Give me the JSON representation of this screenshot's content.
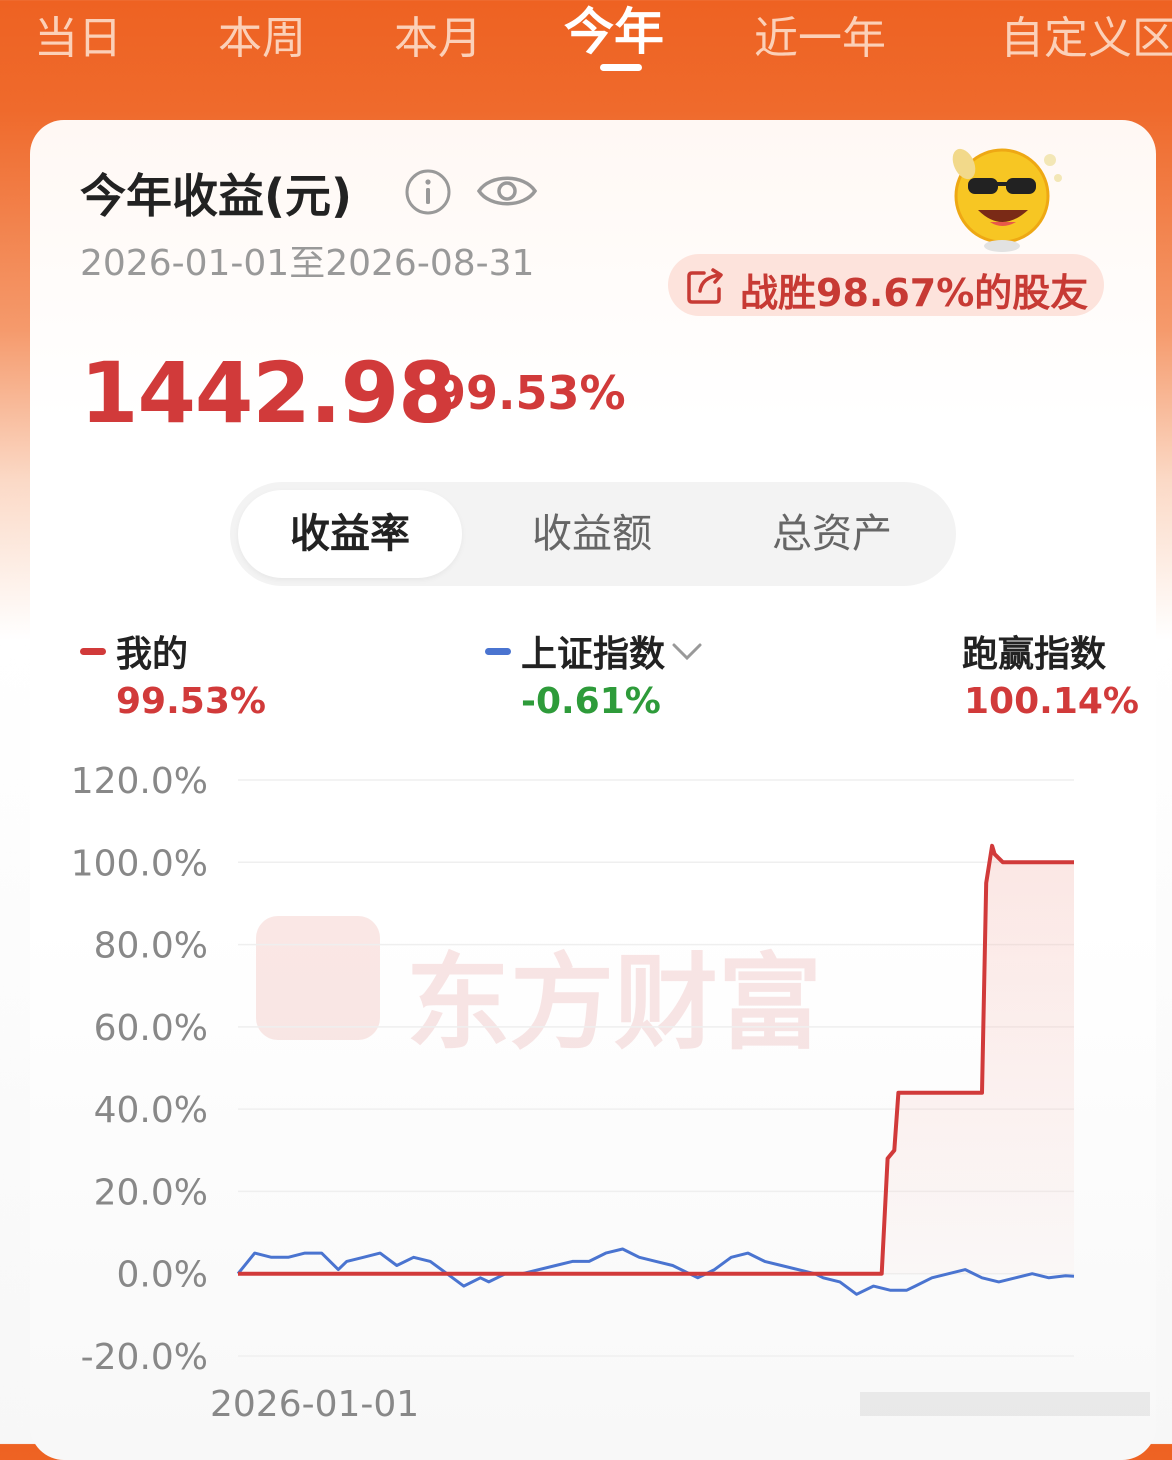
{
  "period_tabs": [
    {
      "label": "当日",
      "active": false
    },
    {
      "label": "本周",
      "active": false
    },
    {
      "label": "本月",
      "active": false
    },
    {
      "label": "今年",
      "active": true
    },
    {
      "label": "近一年",
      "active": false
    },
    {
      "label": "自定义区",
      "active": false
    }
  ],
  "card": {
    "title": "今年收益(元)",
    "date_range": "2026-01-01至2026-08-31",
    "beat_text": "战胜98.67%的股友",
    "amount": "1442.98",
    "amount_rate": "99.53%"
  },
  "segments": [
    {
      "label": "收益率",
      "active": true
    },
    {
      "label": "收益额",
      "active": false
    },
    {
      "label": "总资产",
      "active": false
    }
  ],
  "legend": {
    "mine": {
      "name": "我的",
      "value": "99.53%"
    },
    "index": {
      "name": "上证指数",
      "value": "-0.61%"
    },
    "outperform": {
      "name": "跑赢指数",
      "value": "100.14%"
    }
  },
  "colors": {
    "brand_orange": "#ee6222",
    "up_red": "#d13a3a",
    "down_green": "#2e9b3a",
    "index_blue": "#4a74d0"
  },
  "watermark": {
    "text": "东方财富"
  },
  "chart_data": {
    "type": "line",
    "ylim": [
      -20,
      120
    ],
    "yticks": [
      "120.0%",
      "100.0%",
      "80.0%",
      "60.0%",
      "40.0%",
      "20.0%",
      "0.0%",
      "-20.0%"
    ],
    "x_start_label": "2026-01-01",
    "series": [
      {
        "name": "我的",
        "x": [
          0,
          0.77,
          0.777,
          0.785,
          0.79,
          0.795,
          0.8,
          0.89,
          0.895,
          0.902,
          0.905,
          0.915,
          0.93,
          1.0
        ],
        "values": [
          0,
          0,
          28,
          30,
          44,
          44,
          44,
          44,
          95,
          104,
          102,
          100,
          100,
          100
        ]
      },
      {
        "name": "上证指数",
        "x": [
          0,
          0.02,
          0.04,
          0.06,
          0.08,
          0.1,
          0.12,
          0.13,
          0.15,
          0.17,
          0.19,
          0.21,
          0.23,
          0.25,
          0.27,
          0.29,
          0.3,
          0.32,
          0.34,
          0.36,
          0.38,
          0.4,
          0.42,
          0.44,
          0.46,
          0.48,
          0.5,
          0.52,
          0.54,
          0.55,
          0.57,
          0.59,
          0.61,
          0.63,
          0.65,
          0.67,
          0.69,
          0.7,
          0.72,
          0.74,
          0.76,
          0.78,
          0.8,
          0.81,
          0.83,
          0.85,
          0.87,
          0.89,
          0.91,
          0.93,
          0.95,
          0.97,
          0.99,
          1.0
        ],
        "values": [
          0,
          5,
          4,
          4,
          5,
          5,
          1,
          3,
          4,
          5,
          2,
          4,
          3,
          0,
          -3,
          -1,
          -2,
          0,
          0,
          1,
          2,
          3,
          3,
          5,
          6,
          4,
          3,
          2,
          0,
          -1,
          1,
          4,
          5,
          3,
          2,
          1,
          0,
          -1,
          -2,
          -5,
          -3,
          -4,
          -4,
          -3,
          -1,
          0,
          1,
          -1,
          -2,
          -1,
          0,
          -1,
          -0.5,
          -0.61
        ]
      }
    ]
  }
}
